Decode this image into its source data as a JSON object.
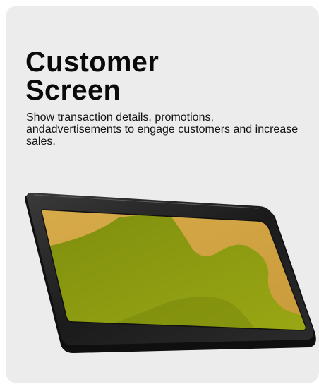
{
  "card": {
    "title_line1": "Customer",
    "title_line2": "Screen",
    "description": "Show transaction details, promotions, andadvertisements to engage customers and increase sales."
  },
  "device": {
    "image": "customer-display-tablet",
    "colors": {
      "bezel": "#1e1e1e",
      "screen_gold": "#d3a646",
      "screen_olive": "#8b9a10"
    }
  }
}
